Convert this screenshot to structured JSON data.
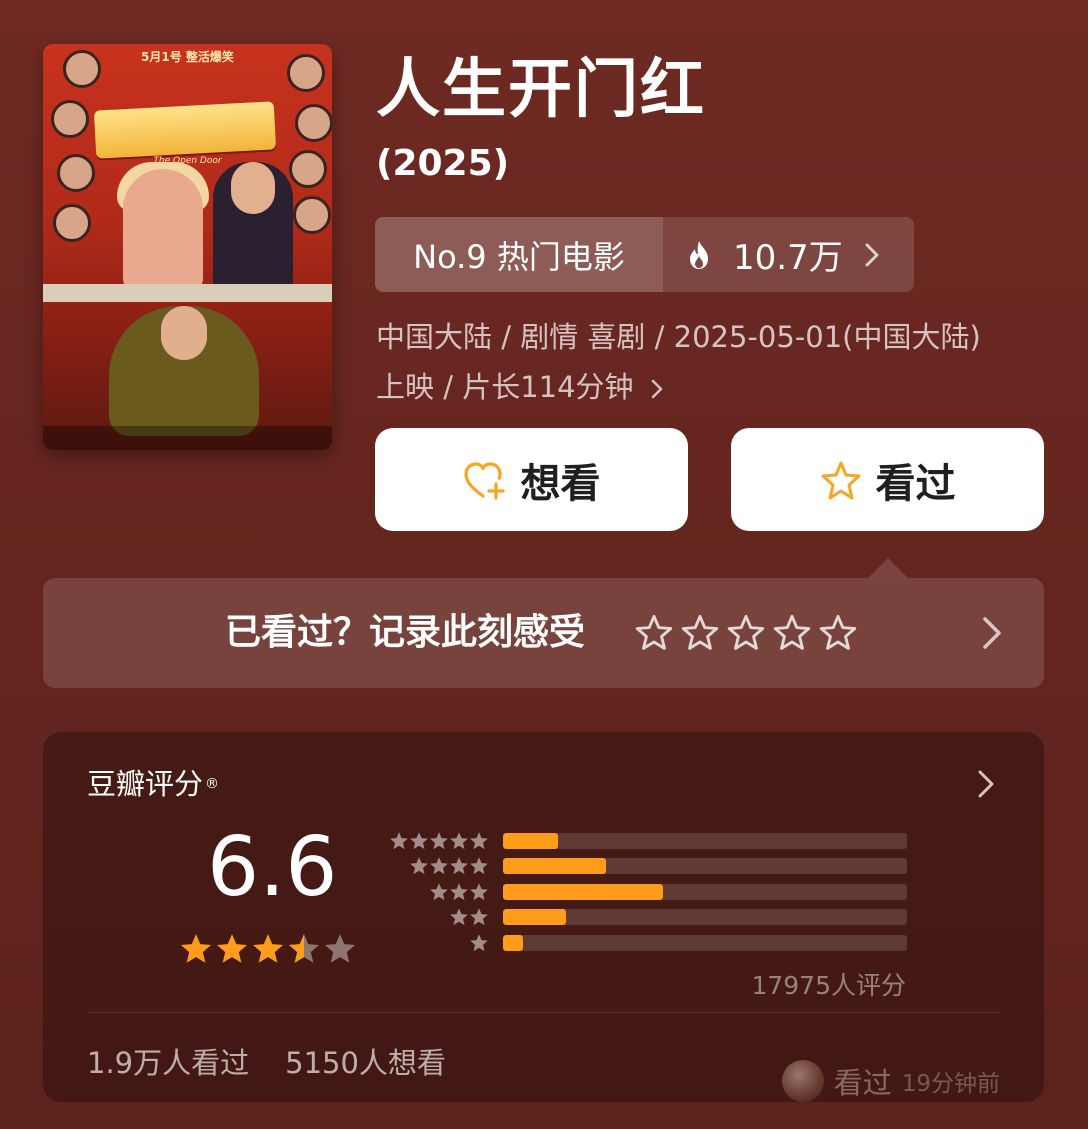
{
  "movie": {
    "title": "人生开门红",
    "year": "(2025)",
    "poster": {
      "tagline": "5月1号 整活爆笑",
      "english_title": "The Open Door"
    }
  },
  "rank": {
    "label": "No.9 热门电影",
    "heat": "10.7万",
    "icon": "fire-icon"
  },
  "meta": {
    "line1": "中国大陆 / 剧情 喜剧 / 2025-05-01(中国大陆)",
    "line2": "上映 / 片长114分钟"
  },
  "actions": {
    "want_label": "想看",
    "seen_label": "看过",
    "accent": "#f5a623"
  },
  "record": {
    "prompt": "已看过？记录此刻感受",
    "star_count": 5
  },
  "rating": {
    "title": "豆瓣评分",
    "trademark": "®",
    "score": "6.6",
    "score_value": 6.6,
    "score_stars": 3.5,
    "distribution": [
      {
        "stars": 5,
        "fraction": 0.135
      },
      {
        "stars": 4,
        "fraction": 0.255
      },
      {
        "stars": 3,
        "fraction": 0.395
      },
      {
        "stars": 2,
        "fraction": 0.155
      },
      {
        "stars": 1,
        "fraction": 0.05
      }
    ],
    "count_text": "17975人评分",
    "seen_text": "1.9万人看过",
    "want_text": "5150人想看",
    "bar_color": "#ff9d1a"
  },
  "recent_activity": {
    "label": "看过",
    "time": "19分钟前"
  }
}
